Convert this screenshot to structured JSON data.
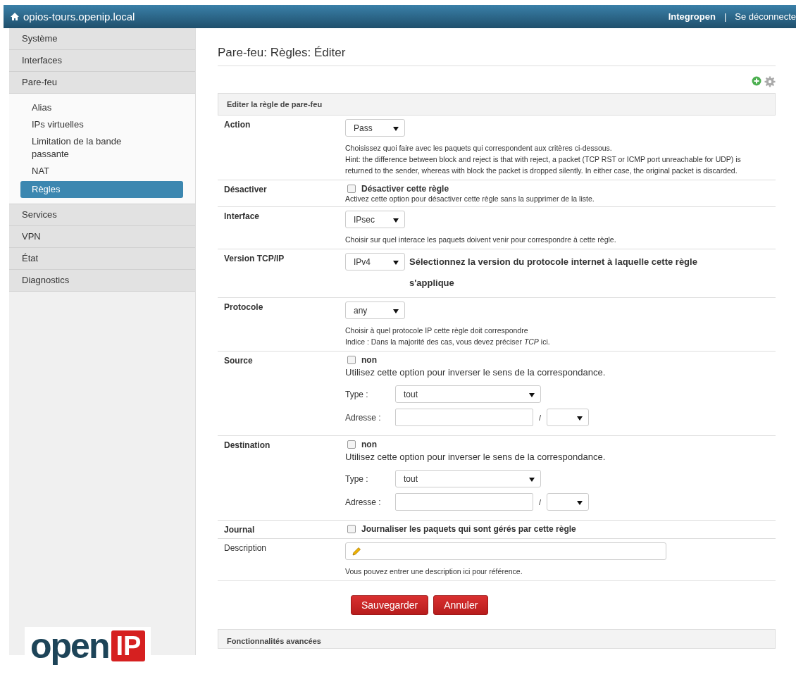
{
  "header": {
    "title": "opios-tours.openip.local",
    "user": "Integropen",
    "separator": "|",
    "logout": "Se déconnecte"
  },
  "sidebar": {
    "items": [
      {
        "label": "Système"
      },
      {
        "label": "Interfaces"
      },
      {
        "label": "Pare-feu",
        "children": [
          {
            "label": "Alias",
            "selected": false
          },
          {
            "label": "IPs virtuelles",
            "selected": false
          },
          {
            "label": "Limitation de la bande passante",
            "selected": false
          },
          {
            "label": "NAT",
            "selected": false
          },
          {
            "label": "Règles",
            "selected": true
          }
        ]
      },
      {
        "label": "Services"
      },
      {
        "label": "VPN"
      },
      {
        "label": "État"
      },
      {
        "label": "Diagnostics"
      }
    ],
    "logo": {
      "word": "open",
      "badge": "IP"
    }
  },
  "page_title": "Pare-feu: Règles: Éditer",
  "section": "Editer la règle de pare-feu",
  "rows": [
    {
      "kind": "select",
      "label": "Action",
      "value": "Pass",
      "help": [
        "Choisissez quoi faire avec les paquets qui correspondent aux critères ci-dessous.",
        "Hint: the difference between block and reject is that with reject, a packet (TCP RST or ICMP port unreachable for UDP) is returned to the sender, whereas with block the packet is dropped silently. In either case, the original packet is discarded."
      ]
    },
    {
      "kind": "checkbox",
      "label": "Désactiver",
      "checked": false,
      "check_label": "Désactiver cette règle",
      "help": [
        "Activez cette option pour désactiver cette règle sans la supprimer de la liste."
      ]
    },
    {
      "kind": "select",
      "label": "Interface",
      "value": "IPsec",
      "help": [
        "Choisir sur quel interace les paquets doivent venir pour correspondre à cette règle."
      ]
    },
    {
      "kind": "select-note",
      "label": "Version TCP/IP",
      "value": "IPv4",
      "note": "Sélectionnez la version du protocole internet à laquelle cette règle s'applique"
    },
    {
      "kind": "select",
      "label": "Protocole",
      "value": "any",
      "help": [
        "Choisir à quel protocole IP cette règle doit correspondre",
        "Indice : Dans la majorité des cas, vous devez préciser *TCP*  ici."
      ]
    },
    {
      "kind": "address",
      "label": "Source",
      "checked": false,
      "check_label": "non",
      "note": "Utilisez cette option pour inverser le sens de la correspondance.",
      "type_label": "Type :",
      "type_value": "tout",
      "address_label": "Adresse :",
      "slash": "/"
    },
    {
      "kind": "address",
      "label": "Destination",
      "checked": false,
      "check_label": "non",
      "note": "Utilisez cette option pour inverser le sens de la correspondance.",
      "type_label": "Type :",
      "type_value": "tout",
      "address_label": "Adresse :",
      "slash": "/"
    },
    {
      "kind": "checkbox",
      "label": "Journal",
      "checked": false,
      "check_label": "Journaliser les paquets qui sont gérés par cette règle",
      "help": []
    },
    {
      "kind": "text",
      "label": "Description",
      "help": [
        "Vous pouvez entrer une description ici pour référence."
      ]
    }
  ],
  "buttons": [
    {
      "label": "Sauvegarder"
    },
    {
      "label": "Annuler"
    }
  ],
  "advanced": "Fonctionnalités avancées"
}
